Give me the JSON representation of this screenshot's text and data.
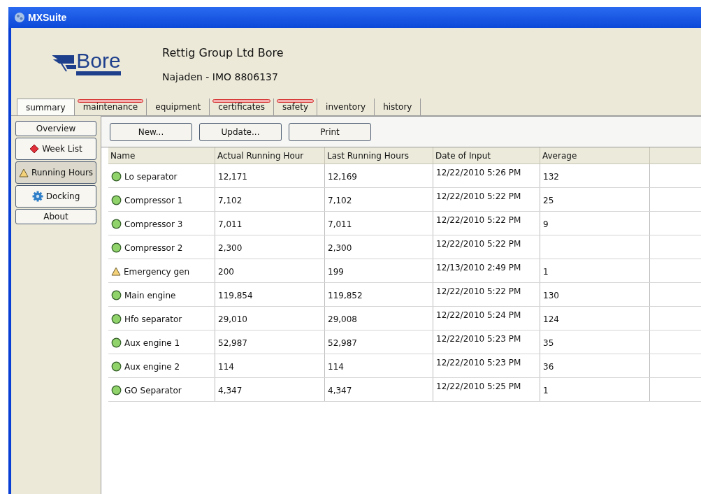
{
  "window": {
    "title": "MXSuite"
  },
  "header": {
    "logo_text": "Bore",
    "company": "Rettig Group Ltd Bore",
    "vessel": "Najaden - IMO 8806137"
  },
  "tabs": [
    {
      "label": "summary",
      "selected": true,
      "alert": false
    },
    {
      "label": "maintenance",
      "selected": false,
      "alert": true
    },
    {
      "label": "equipment",
      "selected": false,
      "alert": false
    },
    {
      "label": "certificates",
      "selected": false,
      "alert": true
    },
    {
      "label": "safety",
      "selected": false,
      "alert": true
    },
    {
      "label": "inventory",
      "selected": false,
      "alert": false
    },
    {
      "label": "history",
      "selected": false,
      "alert": false
    }
  ],
  "sidebar": {
    "items": [
      {
        "label": "Overview",
        "kind": "plain",
        "selected": false
      },
      {
        "label": "Week List",
        "kind": "diamond",
        "selected": false
      },
      {
        "label": "Running Hours",
        "kind": "warning",
        "selected": true
      },
      {
        "label": "Docking",
        "kind": "gear",
        "selected": false
      },
      {
        "label": "About",
        "kind": "plain",
        "selected": false
      }
    ]
  },
  "toolbar": {
    "buttons": [
      "New...",
      "Update...",
      "Print"
    ]
  },
  "table": {
    "columns": [
      "Name",
      "Actual Running Hour",
      "Last Running Hours",
      "Date of Input",
      "Average"
    ],
    "rows": [
      {
        "kind": "ok",
        "cells": [
          "Lo  separator",
          "12,171",
          "12,169",
          "12/22/2010 5:26 PM",
          "132"
        ]
      },
      {
        "kind": "ok",
        "cells": [
          "Compressor 1",
          "7,102",
          "7,102",
          "12/22/2010 5:22 PM",
          "25"
        ]
      },
      {
        "kind": "ok",
        "cells": [
          "Compressor 3",
          "7,011",
          "7,011",
          "12/22/2010 5:22 PM",
          "9"
        ]
      },
      {
        "kind": "ok",
        "cells": [
          "Compressor 2",
          "2,300",
          "2,300",
          "12/22/2010 5:22 PM",
          ""
        ]
      },
      {
        "kind": "warning",
        "cells": [
          "Emergency gen",
          "200",
          "199",
          "12/13/2010 2:49 PM",
          "1"
        ]
      },
      {
        "kind": "ok",
        "cells": [
          "Main engine",
          "119,854",
          "119,852",
          "12/22/2010 5:22 PM",
          "130"
        ]
      },
      {
        "kind": "ok",
        "cells": [
          "Hfo separator",
          "29,010",
          "29,008",
          "12/22/2010 5:24 PM",
          "124"
        ]
      },
      {
        "kind": "ok",
        "cells": [
          "Aux engine 1",
          "52,987",
          "52,987",
          "12/22/2010 5:23 PM",
          "35"
        ]
      },
      {
        "kind": "ok",
        "cells": [
          "Aux engine 2",
          "114",
          "114",
          "12/22/2010 5:23 PM",
          "36"
        ]
      },
      {
        "kind": "ok",
        "cells": [
          "GO Separator",
          "4,347",
          "4,347",
          "12/22/2010 5:25 PM",
          "1"
        ]
      }
    ]
  }
}
